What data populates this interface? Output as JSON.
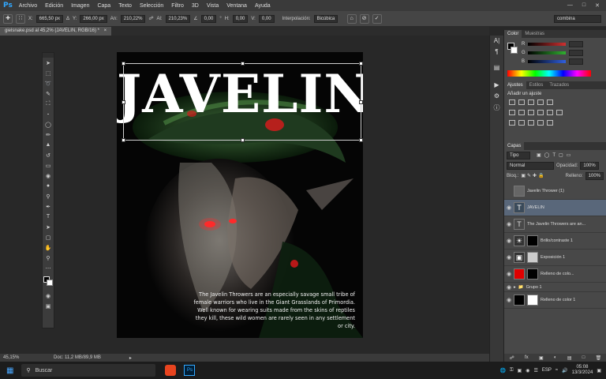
{
  "app": {
    "menu": [
      "Archivo",
      "Edición",
      "Imagen",
      "Capa",
      "Texto",
      "Selección",
      "Filtro",
      "3D",
      "Vista",
      "Ventana",
      "Ayuda"
    ],
    "logo": "Ps"
  },
  "options": {
    "x_label": "X:",
    "x_value": "665,50 px",
    "y_label": "Y:",
    "y_value": "266,00 px",
    "w_label": "An:",
    "w_value": "210,22%",
    "h_label": "Al:",
    "h_value": "210,23%",
    "angle_value": "0,00",
    "hskew_label": "H:",
    "hskew_value": "0,00",
    "vskew_label": "V:",
    "vskew_value": "0,00",
    "interp_label": "Interpolación:",
    "interp_value": "Bicúbica",
    "workspace_value": "combina"
  },
  "document": {
    "tab_title": "gielsnake.psd al 45,2% (JAVELIN, RGB/16) *",
    "headline": "JAVELIN",
    "body_lines": [
      "The Javelin Throwers are an especially savage small tribe of",
      "female warriors who live in the Giant Grasslands of Primordia.",
      "Well known for wearing suits made from the skins of reptiles",
      "they kill, these wild women are rarely seen in any settlement",
      "or city."
    ]
  },
  "status": {
    "zoom": "45,15%",
    "doc": "Doc: 11,2 MB/89,9 MB"
  },
  "color_panel": {
    "tabs": [
      "Color",
      "Muestras"
    ],
    "channels": [
      "R",
      "G",
      "B"
    ],
    "colors": {
      "r": "#d03030",
      "g": "#30b030",
      "b": "#3060e0"
    }
  },
  "adjust_panel": {
    "tabs": [
      "Ajustes",
      "Estilos",
      "Trazados"
    ],
    "title": "Añadir un ajuste"
  },
  "layers_panel": {
    "tab": "Capas",
    "filter": "Tipo",
    "blend": "Normal",
    "opacity_label": "Opacidad:",
    "opacity_value": "100%",
    "lock_label": "Bloq.:",
    "fill_label": "Relleno:",
    "fill_value": "100%",
    "layers": [
      {
        "name": "Javelin Thrower (1)"
      },
      {
        "name": "JAVELIN"
      },
      {
        "name": "The Javelin Throwers are an..."
      },
      {
        "name": "Brillo/contraste 1"
      },
      {
        "name": "Exposición 1"
      },
      {
        "name": "Relleno de colo..."
      },
      {
        "name": "Grupo 1"
      },
      {
        "name": "Relleno de color 1"
      }
    ]
  },
  "taskbar": {
    "search_placeholder": "Buscar",
    "lang": "ESP",
    "time": "05:08",
    "date": "13/3/2024"
  }
}
